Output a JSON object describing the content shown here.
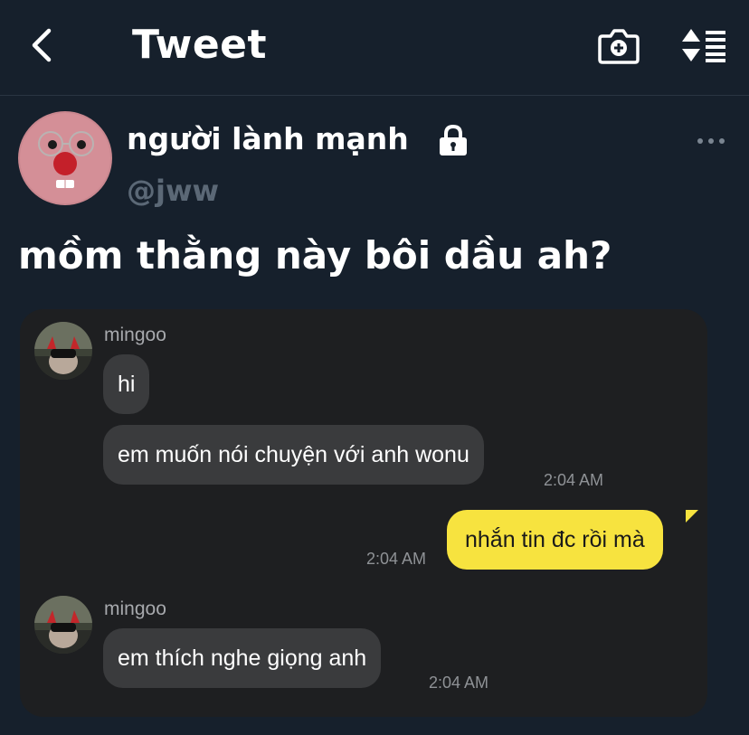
{
  "header": {
    "title": "Tweet",
    "back_icon": "chevron-left-icon",
    "camera_icon": "camera-plus-icon",
    "sort_icon": "sort-arrows-icon"
  },
  "tweet": {
    "display_name": "người lành mạnh",
    "username": "@jww",
    "text": "mồm thằng này bôi dầu ah?",
    "protected_icon": "lock-icon",
    "more_icon": "more-dots-icon"
  },
  "chat": {
    "messages": [
      {
        "sender": "mingoo",
        "text": "hi"
      },
      {
        "text": "em muốn nói chuyện với anh wonu",
        "time": "2:04 AM"
      },
      {
        "text": "nhắn tin đc rồi mà",
        "time": "2:04 AM",
        "mine": true
      },
      {
        "sender": "mingoo",
        "text": "em thích nghe giọng anh",
        "time": "2:04 AM"
      }
    ]
  },
  "colors": {
    "background": "#16202c",
    "username": "#5b6876",
    "chat_bg": "#1e1f21",
    "bubble_in": "#3a3b3d",
    "bubble_out": "#f7e33f"
  }
}
